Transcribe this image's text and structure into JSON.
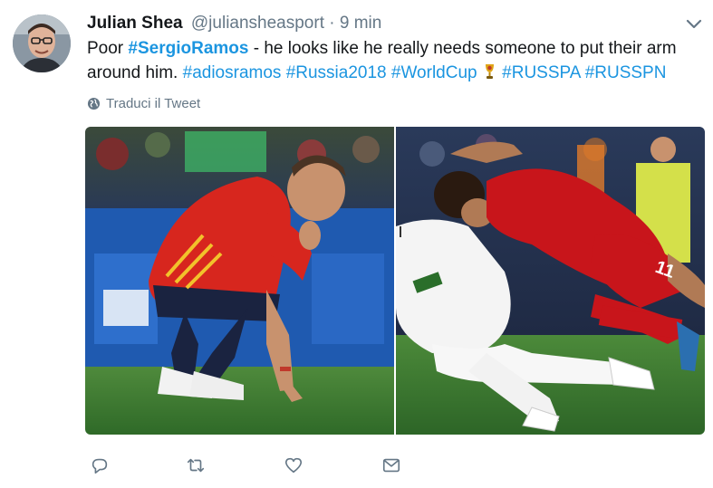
{
  "author": {
    "name": "Julian Shea",
    "handle": "@juliansheasport",
    "separator": "·",
    "time": "9 min"
  },
  "tweet": {
    "text_prefix": "Poor ",
    "mention_tag": "#SergioRamos",
    "text_body": " - he looks like he really needs someone to put their arm around him. ",
    "hashtags_before_emoji": [
      "#adiosramos",
      "#Russia2018",
      "#WorldCup"
    ],
    "emoji": "trophy-icon",
    "hashtags_after_emoji": [
      "#RUSSPA",
      "#RUSSPN"
    ]
  },
  "translate_label": "Traduci il Tweet",
  "media": {
    "photos": [
      {
        "name": "photo-ramos-crouching"
      },
      {
        "name": "photo-salah-tackle"
      }
    ],
    "jersey_number": "11"
  },
  "actions": [
    "reply-icon",
    "retweet-icon",
    "like-icon",
    "direct-message-icon"
  ],
  "colors": {
    "link": "#1b95e0",
    "muted": "#657786",
    "text": "#14171a"
  }
}
